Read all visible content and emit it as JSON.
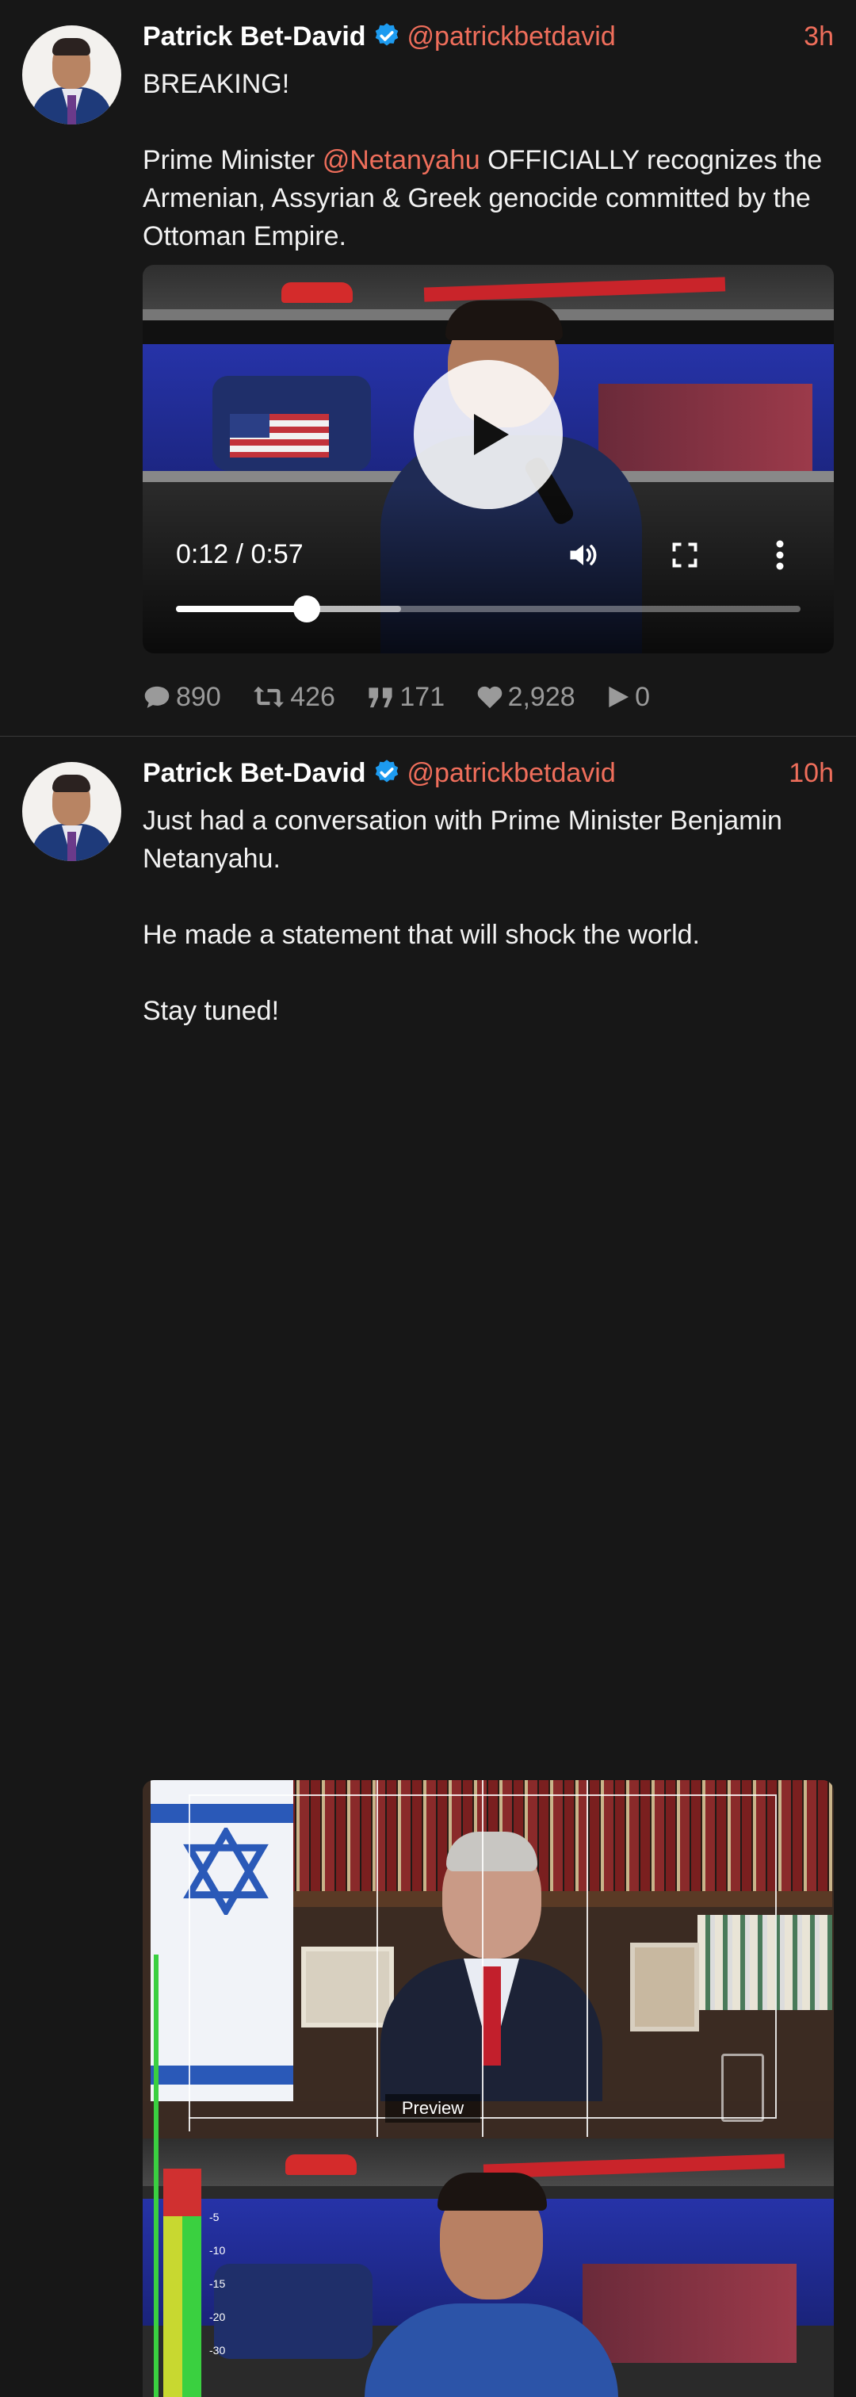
{
  "posts": [
    {
      "author": "Patrick Bet-David",
      "handle": "@patrickbetdavid",
      "time": "3h",
      "text_line1": "BREAKING!",
      "text_prefix": "Prime Minister ",
      "mention": "@Netanyahu",
      "text_suffix": " OFFICIALLY recognizes the Armenian, Assyrian & Greek genocide committed by the Ottoman Empire.",
      "video": {
        "current_time": "0:12",
        "duration": "0:57",
        "time_display": "0:12 / 0:57",
        "progress_fraction": 0.21,
        "buffered_fraction": 0.36
      },
      "stats": {
        "replies": "890",
        "reposts": "426",
        "quotes": "171",
        "likes": "2,928",
        "views": "0"
      }
    },
    {
      "author": "Patrick Bet-David",
      "handle": "@patrickbetdavid",
      "time": "10h",
      "text_line1": "Just had a conversation with Prime Minister Benjamin Netanyahu.",
      "text_line2": "He made a statement that will shock the world.",
      "text_line3": "Stay tuned!",
      "image_overlay": {
        "preview_label": "Preview",
        "meter_labels": [
          "-5",
          "-10",
          "-15",
          "-20",
          "-30"
        ]
      }
    }
  ],
  "colors": {
    "background": "#171717",
    "accent": "#ef6e5b",
    "verified": "#1d9bf0",
    "muted": "#9a9a9a"
  },
  "icons": {
    "verified": "verified-badge-icon",
    "play": "play-icon",
    "volume": "volume-icon",
    "fullscreen": "fullscreen-icon",
    "more": "more-vertical-icon",
    "reply": "comment-icon",
    "repost": "repost-icon",
    "quote": "quote-icon",
    "like": "heart-icon",
    "views": "play-count-icon"
  }
}
